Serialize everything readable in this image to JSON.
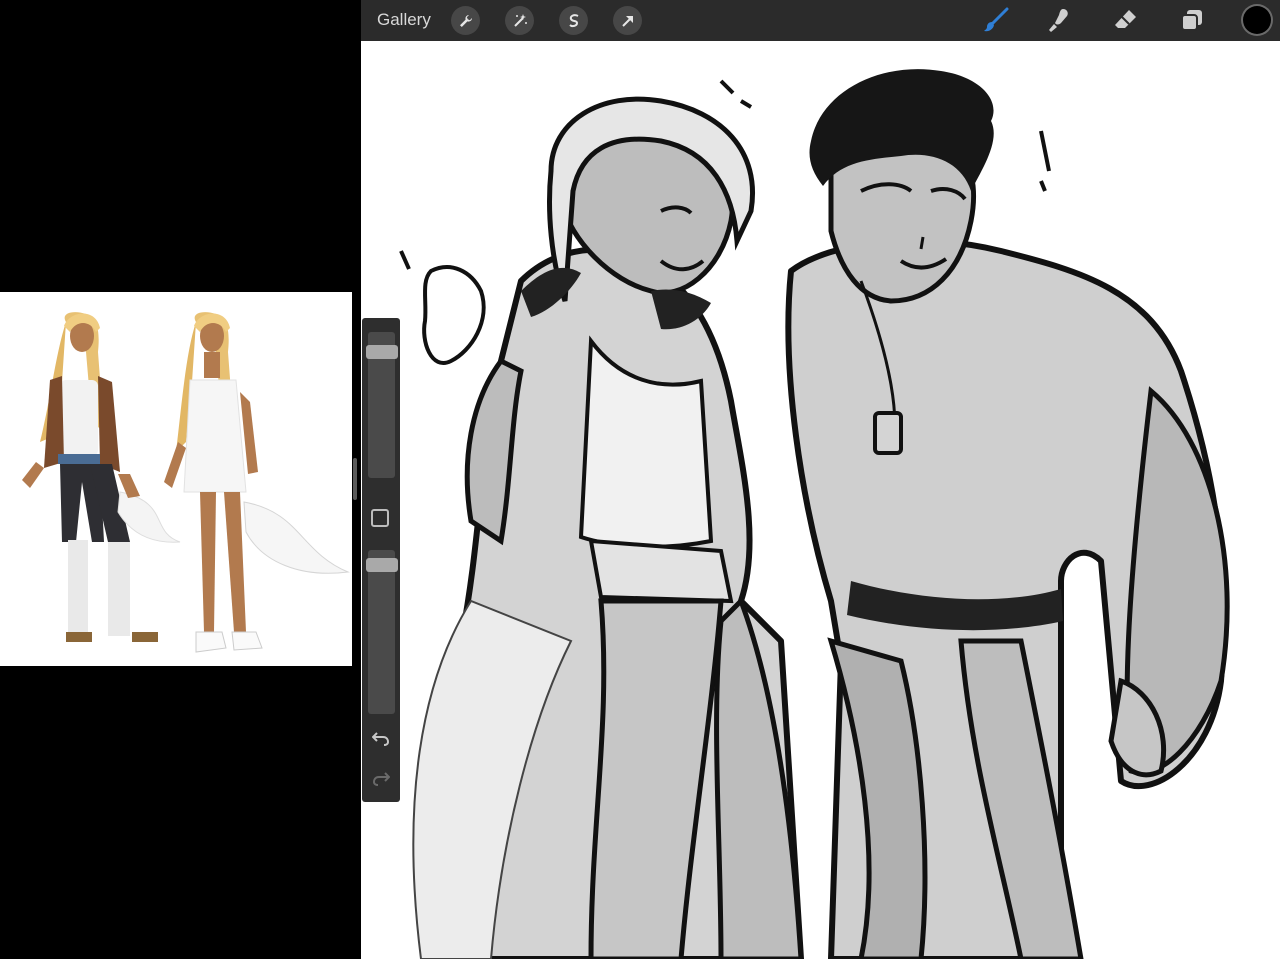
{
  "toolbar": {
    "gallery_label": "Gallery",
    "left_tools": [
      "wrench-icon",
      "magic-wand-icon",
      "selection-icon",
      "transform-arrow-icon"
    ],
    "right_tools": [
      "brush-icon",
      "smudge-icon",
      "eraser-icon",
      "layers-icon"
    ],
    "active_tool": "brush",
    "active_color": "#000000",
    "accent_color": "#2f7fd6"
  },
  "sidebar": {
    "brush_size": 0.9,
    "brush_opacity": 0.95,
    "undo_icon": "undo-icon",
    "redo_icon": "redo-icon"
  },
  "reference": {
    "description_visible": false
  }
}
